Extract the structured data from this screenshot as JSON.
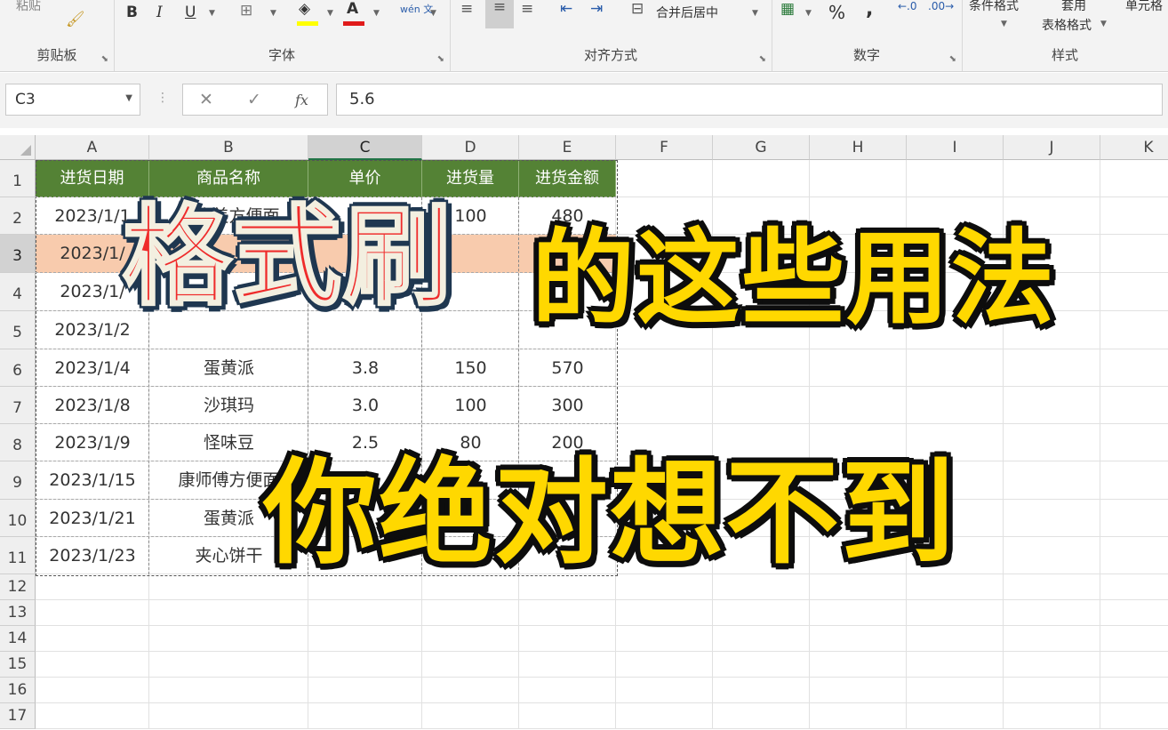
{
  "ribbon": {
    "clipboard": {
      "label": "剪贴板",
      "paste": "粘贴"
    },
    "font": {
      "label": "字体",
      "bold": "B",
      "italic": "I",
      "underline": "U",
      "phonetic": "wén 文"
    },
    "alignment": {
      "label": "对齐方式",
      "merge": "合并后居中"
    },
    "number": {
      "label": "数字",
      "percent": "%",
      "comma": ","
    },
    "styles": {
      "label": "样式",
      "conditional": "条件格式",
      "table_format_1": "套用",
      "table_format_2": "表格格式",
      "cell_styles": "单元格"
    }
  },
  "formula_bar": {
    "name_box": "C3",
    "cancel": "✕",
    "enter": "✓",
    "fx": "fx",
    "content": "5.6"
  },
  "columns": [
    "A",
    "B",
    "C",
    "D",
    "E",
    "F",
    "G",
    "H",
    "I",
    "J",
    "K"
  ],
  "rows": [
    "1",
    "2",
    "3",
    "4",
    "5",
    "6",
    "7",
    "8",
    "9",
    "10",
    "11",
    "12",
    "13",
    "14",
    "15",
    "16",
    "17"
  ],
  "table": {
    "headers": [
      "进货日期",
      "商品名称",
      "单价",
      "进货量",
      "进货金额"
    ],
    "rows": [
      [
        "2023/1/1",
        "好吃美方便面",
        "4.8",
        "100",
        "480"
      ],
      [
        "2023/1/",
        "",
        "",
        "",
        ""
      ],
      [
        "2023/1/",
        "",
        "9",
        "",
        ""
      ],
      [
        "2023/1/2",
        "",
        "",
        "",
        ""
      ],
      [
        "2023/1/4",
        "蛋黄派",
        "3.8",
        "150",
        "570"
      ],
      [
        "2023/1/8",
        "沙琪玛",
        "3.0",
        "100",
        "300"
      ],
      [
        "2023/1/9",
        "怪味豆",
        "2.5",
        "80",
        "200"
      ],
      [
        "2023/1/15",
        "康师傅方便面",
        "",
        "",
        ""
      ],
      [
        "2023/1/21",
        "蛋黄派",
        "",
        "",
        ""
      ],
      [
        "2023/1/23",
        "夹心饼干",
        "",
        "",
        ""
      ]
    ]
  },
  "overlay": {
    "line1": "格式刷",
    "line2": "的这些用法",
    "line3": "你绝对想不到"
  },
  "colors": {
    "header_green": "#548235",
    "selected_row": "#f8cbad",
    "overlay_red": "#ef2b2b",
    "overlay_yellow": "#ffd800"
  },
  "icons": [
    "format-painter-icon",
    "border-icon",
    "fill-color-icon",
    "font-color-icon",
    "align-left-icon",
    "align-center-icon",
    "align-right-icon",
    "decrease-indent-icon",
    "increase-indent-icon",
    "merge-icon",
    "currency-icon",
    "increase-decimal-icon",
    "decrease-decimal-icon",
    "select-all-icon"
  ]
}
